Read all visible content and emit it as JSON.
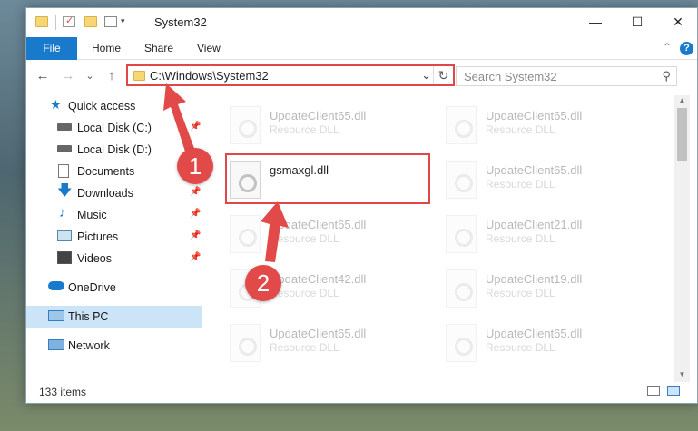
{
  "window": {
    "title": "System32",
    "controls": {
      "minimize": "—",
      "maximize": "☐",
      "close": "✕"
    }
  },
  "ribbon": {
    "tabs": [
      "File",
      "Home",
      "Share",
      "View"
    ],
    "collapse_icon": "chevron-up-icon",
    "help": "?"
  },
  "nav": {
    "back": "←",
    "forward": "→",
    "recent": "⌄",
    "up": "↑",
    "address": "C:\\Windows\\System32",
    "address_dropdown": "⌄",
    "refresh": "↻",
    "search_placeholder": "Search System32",
    "search_icon": "⚲"
  },
  "sidebar": {
    "items": [
      {
        "label": "Quick access",
        "icon": "star-icon",
        "pinned": false
      },
      {
        "label": "Local Disk (C:)",
        "icon": "drive-icon",
        "pinned": true
      },
      {
        "label": "Local Disk (D:)",
        "icon": "drive-icon",
        "pinned": false
      },
      {
        "label": "Documents",
        "icon": "documents-icon",
        "pinned": true
      },
      {
        "label": "Downloads",
        "icon": "download-icon",
        "pinned": true
      },
      {
        "label": "Music",
        "icon": "music-icon",
        "pinned": true
      },
      {
        "label": "Pictures",
        "icon": "pictures-icon",
        "pinned": true
      },
      {
        "label": "Videos",
        "icon": "videos-icon",
        "pinned": true
      },
      {
        "label": "OneDrive",
        "icon": "cloud-icon",
        "pinned": false
      },
      {
        "label": "This PC",
        "icon": "computer-icon",
        "pinned": false
      },
      {
        "label": "Network",
        "icon": "network-icon",
        "pinned": false
      }
    ],
    "pin_glyph": "📌"
  },
  "files": {
    "highlighted": {
      "name": "gsmaxgl.dll"
    },
    "faded": [
      {
        "name": "UpdateClient65.dll",
        "type": "Resource DLL"
      },
      {
        "name": "UpdateClient65.dll",
        "type": "Resource DLL"
      },
      {
        "name": "UpdateClient65.dll",
        "type": "Resource DLL"
      },
      {
        "name": "UpdateClient65.dll",
        "type": "Resource DLL"
      },
      {
        "name": "UpdateClient21.dll",
        "type": "Resource DLL"
      },
      {
        "name": "UpdateClient42.dll",
        "type": "Resource DLL"
      },
      {
        "name": "UpdateClient19.dll",
        "type": "Resource DLL"
      },
      {
        "name": "UpdateClient65.dll",
        "type": "Resource DLL"
      },
      {
        "name": "UpdateClient65.dll",
        "type": "Resource DLL"
      }
    ]
  },
  "status": {
    "item_count": "133 items"
  },
  "annotations": {
    "step1": "1",
    "step2": "2",
    "color": "#e24a4a"
  },
  "colors": {
    "accent": "#1979ca",
    "highlight": "#e04848",
    "selection": "#cce4f7"
  }
}
